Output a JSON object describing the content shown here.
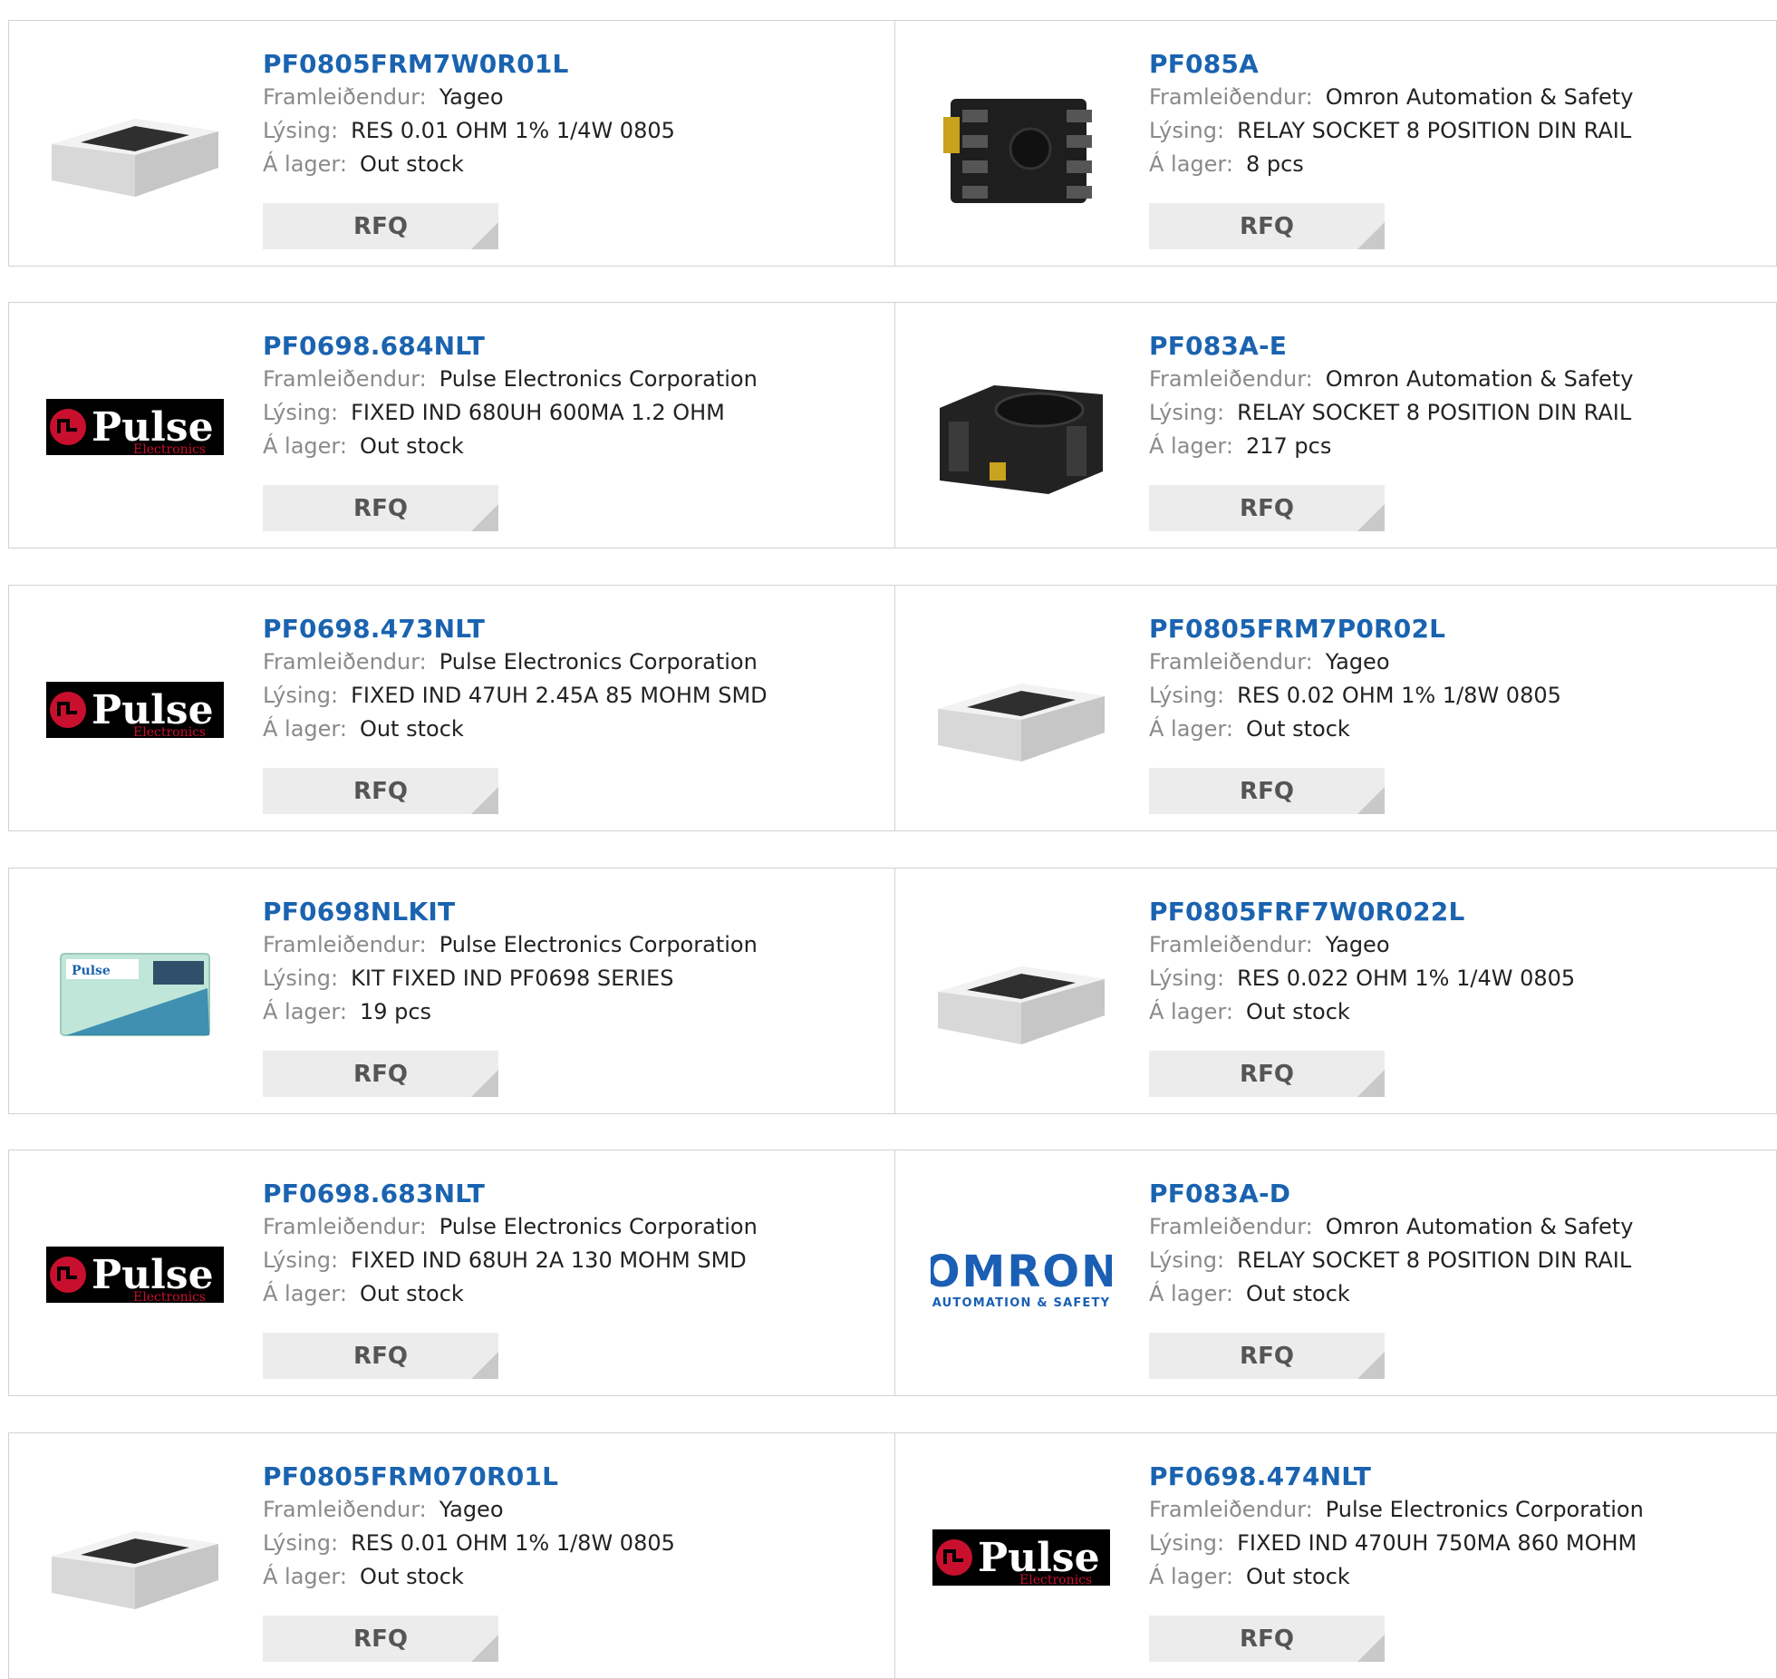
{
  "labels": {
    "manufacturer": "Framleiðendur:",
    "description": "Lýsing:",
    "stock": "Á lager:",
    "rfq": "RFQ"
  },
  "logos": {
    "pulse": {
      "name": "Pulse",
      "sub": "Electronics"
    },
    "omron": {
      "name": "OMRON",
      "sub": "AUTOMATION & SAFETY"
    }
  },
  "products": [
    {
      "pn": "PF0805FRM7W0R01L",
      "manufacturer": "Yageo",
      "description": "RES 0.01 OHM 1% 1/4W 0805",
      "stock": "Out stock",
      "image": "resistor-chip-icon"
    },
    {
      "pn": "PF085A",
      "manufacturer": "Omron Automation & Safety",
      "description": "RELAY SOCKET 8 POSITION DIN RAIL",
      "stock": "8 pcs",
      "image": "relay-socket-icon"
    },
    {
      "pn": "PF0698.684NLT",
      "manufacturer": "Pulse Electronics Corporation",
      "description": "FIXED IND 680UH 600MA 1.2 OHM",
      "stock": "Out stock",
      "image": "pulse-logo-icon"
    },
    {
      "pn": "PF083A-E",
      "manufacturer": "Omron Automation & Safety",
      "description": "RELAY SOCKET 8 POSITION DIN RAIL",
      "stock": "217 pcs",
      "image": "relay-socket-round-icon"
    },
    {
      "pn": "PF0698.473NLT",
      "manufacturer": "Pulse Electronics Corporation",
      "description": "FIXED IND 47UH 2.45A 85 MOHM SMD",
      "stock": "Out stock",
      "image": "pulse-logo-icon"
    },
    {
      "pn": "PF0805FRM7P0R02L",
      "manufacturer": "Yageo",
      "description": "RES 0.02 OHM 1% 1/8W 0805",
      "stock": "Out stock",
      "image": "resistor-chip-icon"
    },
    {
      "pn": "PF0698NLKIT",
      "manufacturer": "Pulse Electronics Corporation",
      "description": "KIT FIXED IND PF0698 SERIES",
      "stock": "19 pcs",
      "image": "sample-kit-icon"
    },
    {
      "pn": "PF0805FRF7W0R022L",
      "manufacturer": "Yageo",
      "description": "RES 0.022 OHM 1% 1/4W 0805",
      "stock": "Out stock",
      "image": "resistor-chip-icon"
    },
    {
      "pn": "PF0698.683NLT",
      "manufacturer": "Pulse Electronics Corporation",
      "description": "FIXED IND 68UH 2A 130 MOHM SMD",
      "stock": "Out stock",
      "image": "pulse-logo-icon"
    },
    {
      "pn": "PF083A-D",
      "manufacturer": "Omron Automation & Safety",
      "description": "RELAY SOCKET 8 POSITION DIN RAIL",
      "stock": "Out stock",
      "image": "omron-logo-icon"
    },
    {
      "pn": "PF0805FRM070R01L",
      "manufacturer": "Yageo",
      "description": "RES 0.01 OHM 1% 1/8W 0805",
      "stock": "Out stock",
      "image": "resistor-chip-icon"
    },
    {
      "pn": "PF0698.474NLT",
      "manufacturer": "Pulse Electronics Corporation",
      "description": "FIXED IND 470UH 750MA 860 MOHM",
      "stock": "Out stock",
      "image": "pulse-logo-icon"
    }
  ]
}
